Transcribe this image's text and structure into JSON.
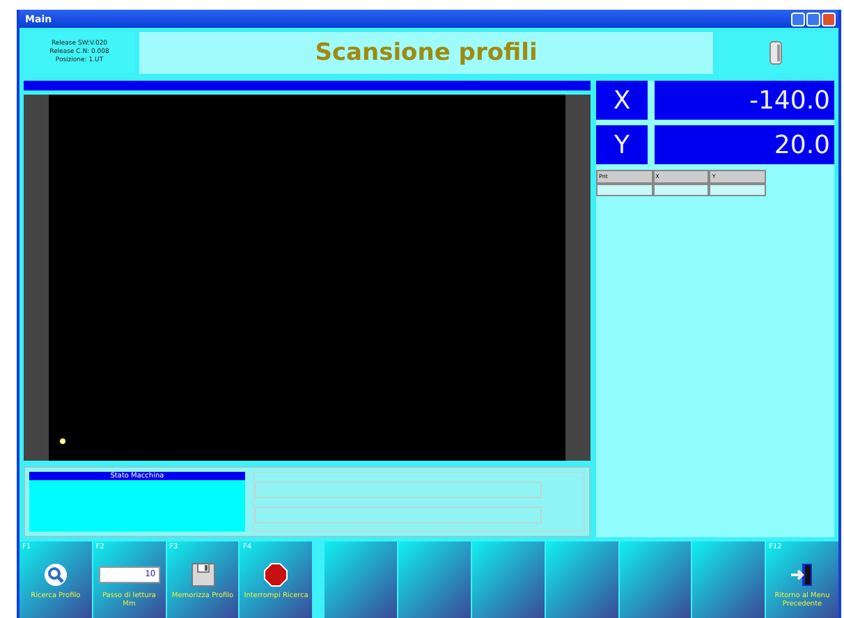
{
  "window": {
    "title": "Main"
  },
  "info": [
    "Release SW:V.020",
    "Release C.N: 0.008",
    "Posizione: 1.UT"
  ],
  "title": "Scansione profili",
  "axes": [
    {
      "label": "X",
      "value": "-140.0"
    },
    {
      "label": "Y",
      "value": "20.0"
    }
  ],
  "table": {
    "columns": [
      "Pnt",
      "X",
      "Y"
    ]
  },
  "status": {
    "title": "Stato Macchina"
  },
  "fkeys": [
    {
      "kind": "search",
      "key": "F1",
      "label": "Ricerca Profilo"
    },
    {
      "kind": "field",
      "key": "F2",
      "value": "10",
      "label": "Passo di lettura Mm"
    },
    {
      "kind": "save",
      "key": "F3",
      "label": "Memorizza Profilo"
    },
    {
      "kind": "stop",
      "key": "F4",
      "label": "Interrompi Ricerca"
    },
    {
      "kind": "empty"
    },
    {
      "kind": "empty"
    },
    {
      "kind": "empty"
    },
    {
      "kind": "empty"
    },
    {
      "kind": "empty"
    },
    {
      "kind": "empty"
    },
    {
      "kind": "exit",
      "key": "F12",
      "label": "Ritorno al Menu Precedente"
    }
  ]
}
